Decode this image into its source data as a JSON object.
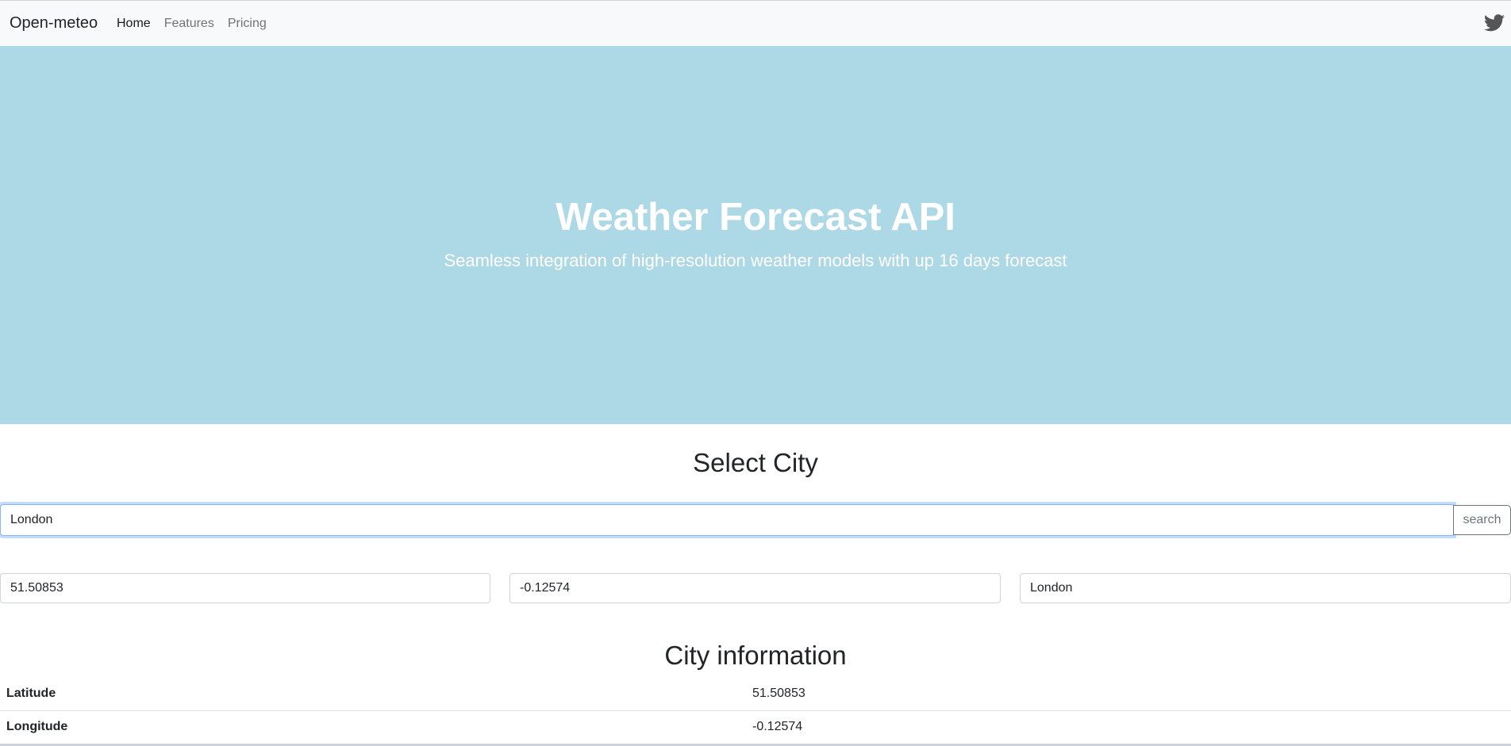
{
  "navbar": {
    "brand": "Open-meteo",
    "links": [
      {
        "label": "Home",
        "active": true
      },
      {
        "label": "Features",
        "active": false
      },
      {
        "label": "Pricing",
        "active": false
      }
    ],
    "social_icon": "twitter-icon"
  },
  "hero": {
    "title": "Weather Forecast API",
    "subtitle": "Seamless integration of high-resolution weather models with up 16 days forecast",
    "background": "#add8e6"
  },
  "city_select": {
    "title": "Select City",
    "search_value": "London",
    "search_button": "search"
  },
  "coordinates": {
    "latitude": "51.50853",
    "longitude": "-0.12574",
    "city": "London"
  },
  "city_info": {
    "title": "City information",
    "rows": [
      {
        "label": "Latitude",
        "value": "51.50853"
      },
      {
        "label": "Longitude",
        "value": "-0.12574"
      }
    ]
  }
}
